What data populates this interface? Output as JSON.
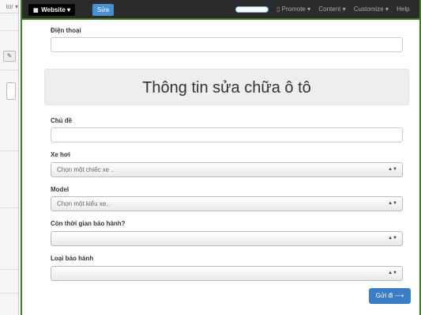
{
  "left_pane": {
    "dropdown_text": "tor ▾",
    "edit_icon_glyph": "✎"
  },
  "topbar": {
    "brand_label": "Website ▾",
    "brand_icon": "grid-icon",
    "edit_label": "Sửa",
    "menu_items": [
      "▯ Promote ▾",
      "Content ▾",
      "Customize ▾",
      "Help"
    ]
  },
  "form": {
    "phone_label": "Điện thoại",
    "heading": "Thông tin sửa chữa ô tô",
    "subject_label": "Chủ đề",
    "car_label": "Xe hơi",
    "car_placeholder": "Chọn một chiếc xe ..",
    "model_label": "Model",
    "model_placeholder": "Chọn một kiểu xe..",
    "warranty_label": "Còn thời gian bảo hành?",
    "warranty_value": "",
    "warranty_type_label": "Loại bảo hành",
    "warranty_type_value": "",
    "submit_label": "Gửi đi ⟶",
    "select_arrow": "▲▼"
  },
  "colors": {
    "accent_green": "#3d7a2a",
    "button_blue": "#3c7ec6",
    "topbar_bg": "#2b2b2b"
  }
}
